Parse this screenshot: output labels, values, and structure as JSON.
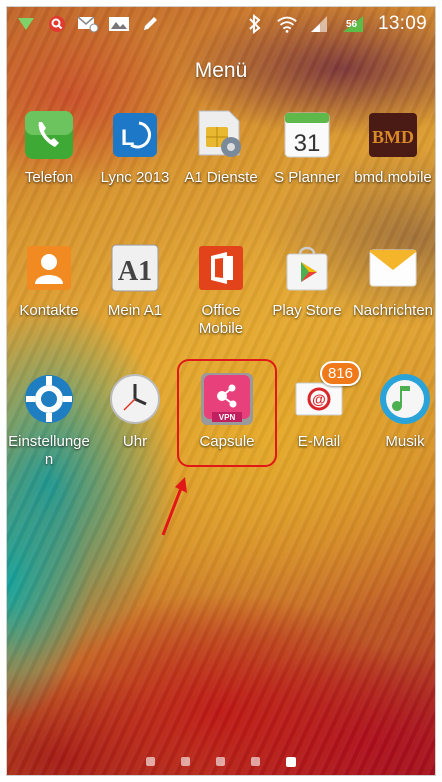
{
  "status_bar": {
    "time": "13:09",
    "network_type": "56",
    "icons_left": [
      "download-icon",
      "location-icon",
      "email-notification-icon",
      "gallery-icon",
      "edit-icon"
    ],
    "icons_right": [
      "bluetooth-icon",
      "wifi-icon",
      "signal-icon",
      "network-icon"
    ]
  },
  "header": {
    "title": "Menü"
  },
  "apps": [
    {
      "label": "Telefon",
      "icon": "phone-icon"
    },
    {
      "label": "Lync 2013",
      "icon": "lync-icon",
      "glyph": "L"
    },
    {
      "label": "A1 Dienste",
      "icon": "sim-settings-icon"
    },
    {
      "label": "S Planner",
      "icon": "calendar-icon",
      "glyph": "31"
    },
    {
      "label": "bmd.mobile",
      "icon": "bmd-icon",
      "glyph": "BMD"
    },
    {
      "label": "Kontakte",
      "icon": "contacts-icon"
    },
    {
      "label": "Mein A1",
      "icon": "a1-icon",
      "glyph": "A1"
    },
    {
      "label": "Office Mobile",
      "icon": "office-icon"
    },
    {
      "label": "Play Store",
      "icon": "play-store-icon"
    },
    {
      "label": "Nachrichten",
      "icon": "messages-icon"
    },
    {
      "label": "Einstellungen",
      "icon": "settings-icon"
    },
    {
      "label": "Uhr",
      "icon": "clock-icon"
    },
    {
      "label": "Capsule",
      "icon": "capsule-vpn-icon",
      "glyph": "VPN"
    },
    {
      "label": "E-Mail",
      "icon": "email-icon",
      "badge": "816"
    },
    {
      "label": "Musik",
      "icon": "music-icon"
    }
  ],
  "page_indicator": {
    "count": 5,
    "active": 5
  },
  "colors": {
    "highlight": "#e01818",
    "badge": "#f07a1a"
  }
}
